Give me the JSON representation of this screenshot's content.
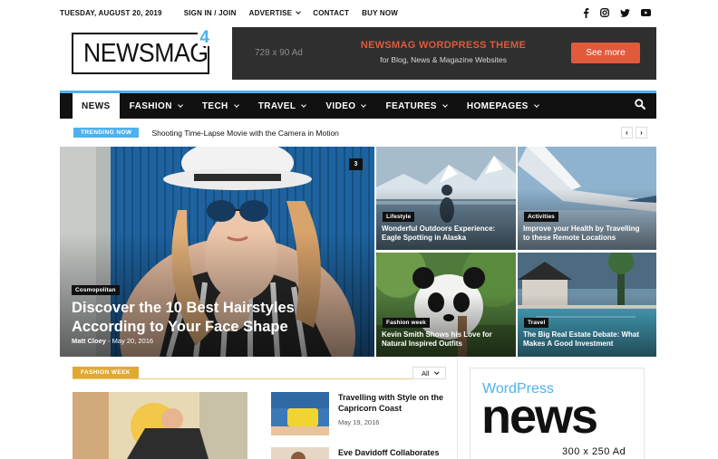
{
  "topbar": {
    "date": "TUESDAY, AUGUST 20, 2019",
    "links": [
      "SIGN IN / JOIN",
      "ADVERTISE",
      "CONTACT",
      "BUY NOW"
    ],
    "social": [
      "facebook-icon",
      "instagram-icon",
      "twitter-icon",
      "youtube-icon"
    ]
  },
  "logo": {
    "name": "NEWSMAG",
    "version": "4"
  },
  "ad_banner": {
    "size_label": "728 x 90 Ad",
    "title": "NEWSMAG WORDPRESS THEME",
    "subtitle": "for Blog, News & Magazine Websites",
    "cta": "See more"
  },
  "nav": {
    "items": [
      {
        "label": "NEWS",
        "dropdown": false
      },
      {
        "label": "FASHION",
        "dropdown": true
      },
      {
        "label": "TECH",
        "dropdown": true
      },
      {
        "label": "TRAVEL",
        "dropdown": true
      },
      {
        "label": "VIDEO",
        "dropdown": true
      },
      {
        "label": "FEATURES",
        "dropdown": true
      },
      {
        "label": "HOMEPAGES",
        "dropdown": true
      }
    ]
  },
  "trending": {
    "badge": "TRENDING NOW",
    "headline": "Shooting Time-Lapse Movie with the Camera in Motion"
  },
  "featured": {
    "main": {
      "category": "Cosmopolitan",
      "title_line1": "Discover the 10 Best Hairstyles",
      "title_line2": "According to Your Face Shape",
      "author": "Matt Cloey",
      "date": "May 20, 2016",
      "comments": "3"
    },
    "tiles": [
      {
        "category": "Lifestyle",
        "line1": "Wonderful Outdoors Experience:",
        "line2": "Eagle Spotting in Alaska"
      },
      {
        "category": "Activities",
        "line1": "Improve your Health by Travelling",
        "line2": "to these Remote Locations"
      },
      {
        "category": "Fashion week",
        "line1": "Kevin Smith Shows his Love for",
        "line2": "Natural Inspired Outfits"
      },
      {
        "category": "Travel",
        "line1": "The Big Real Estate Debate: What",
        "line2": "Makes A Good Investment"
      }
    ]
  },
  "section": {
    "badge": "FASHION WEEK",
    "filter": "All",
    "posts": [
      {
        "line1": "Travelling with Style on the",
        "line2": "Capricorn Coast",
        "date": "May 19, 2016"
      },
      {
        "line1": "Eve Davidoff Collaborates",
        "line2": "",
        "date": ""
      }
    ]
  },
  "sidebar_ad": {
    "brand": "WordPress",
    "word": "news",
    "size": "300 x 250 Ad"
  }
}
